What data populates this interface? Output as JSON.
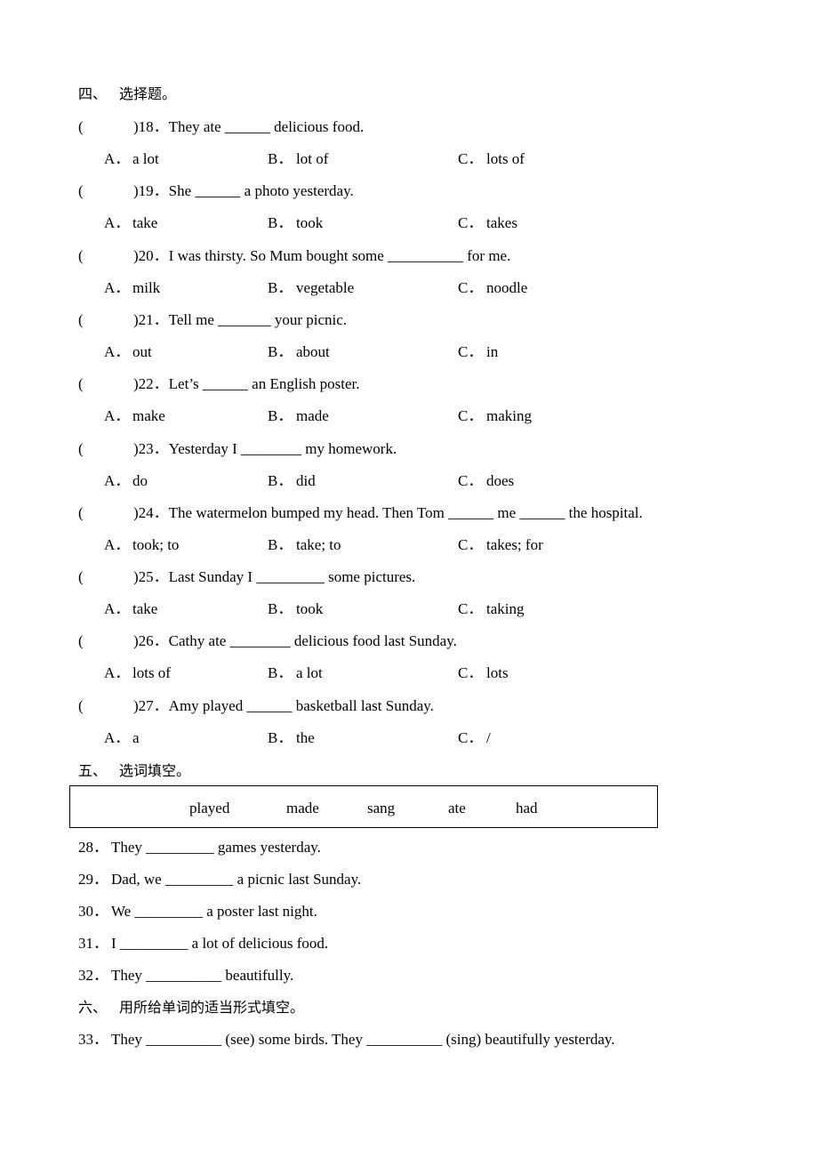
{
  "section4": {
    "number": "四、",
    "title": "选择题。",
    "questions": [
      {
        "paren": "(",
        "text": ")18．They ate ______ delicious food.",
        "options": {
          "a": "a lot",
          "b": "lot of",
          "c": "lots of"
        }
      },
      {
        "paren": "(",
        "text": ")19．She ______ a photo yesterday.",
        "options": {
          "a": "take",
          "b": "took",
          "c": "takes"
        }
      },
      {
        "paren": "(",
        "text": ")20．I was thirsty. So Mum bought some __________ for me.",
        "options": {
          "a": "milk",
          "b": "vegetable",
          "c": "noodle"
        }
      },
      {
        "paren": "(",
        "text": ")21．Tell me _______ your picnic.",
        "options": {
          "a": "out",
          "b": "about",
          "c": "in"
        }
      },
      {
        "paren": "(",
        "text": ")22．Let’s ______ an English poster.",
        "options": {
          "a": "make",
          "b": "made",
          "c": "making"
        }
      },
      {
        "paren": "(",
        "text": ")23．Yesterday I ________ my homework.",
        "options": {
          "a": "do",
          "b": "did",
          "c": "does"
        }
      },
      {
        "paren": "(",
        "text": ")24．The watermelon bumped my head. Then Tom ______ me ______ the hospital.",
        "options": {
          "a": "took; to",
          "b": "take; to",
          "c": "takes; for"
        }
      },
      {
        "paren": "(",
        "text": ")25．Last Sunday I _________ some pictures.",
        "options": {
          "a": "take",
          "b": "took",
          "c": "taking"
        }
      },
      {
        "paren": "(",
        "text": ")26．Cathy ate ________ delicious food last Sunday.",
        "options": {
          "a": "lots of",
          "b": "a lot",
          "c": "lots"
        }
      },
      {
        "paren": "(",
        "text": ")27．Amy played ______ basketball last Sunday.",
        "options": {
          "a": "a",
          "b": "the",
          "c": "/"
        }
      }
    ],
    "option_labels": {
      "a": "A．",
      "b": "B．",
      "c": "C．"
    }
  },
  "section5": {
    "number": "五、",
    "title": "选词填空。",
    "words": [
      "played",
      "made",
      "sang",
      "ate",
      "had"
    ],
    "items": [
      {
        "num": "28．",
        "text": "They  _________  games yesterday."
      },
      {
        "num": "29．",
        "text": "Dad, we  _________  a picnic last Sunday."
      },
      {
        "num": "30．",
        "text": "We  _________  a poster last night."
      },
      {
        "num": "31．",
        "text": "I  _________  a lot of delicious food."
      },
      {
        "num": "32．",
        "text": "They  __________  beautifully."
      }
    ]
  },
  "section6": {
    "number": "六、",
    "title": "用所给单词的适当形式填空。",
    "items": [
      {
        "num": "33．",
        "text": "They  __________  (see) some birds. They  __________  (sing) beautifully yesterday."
      }
    ]
  }
}
